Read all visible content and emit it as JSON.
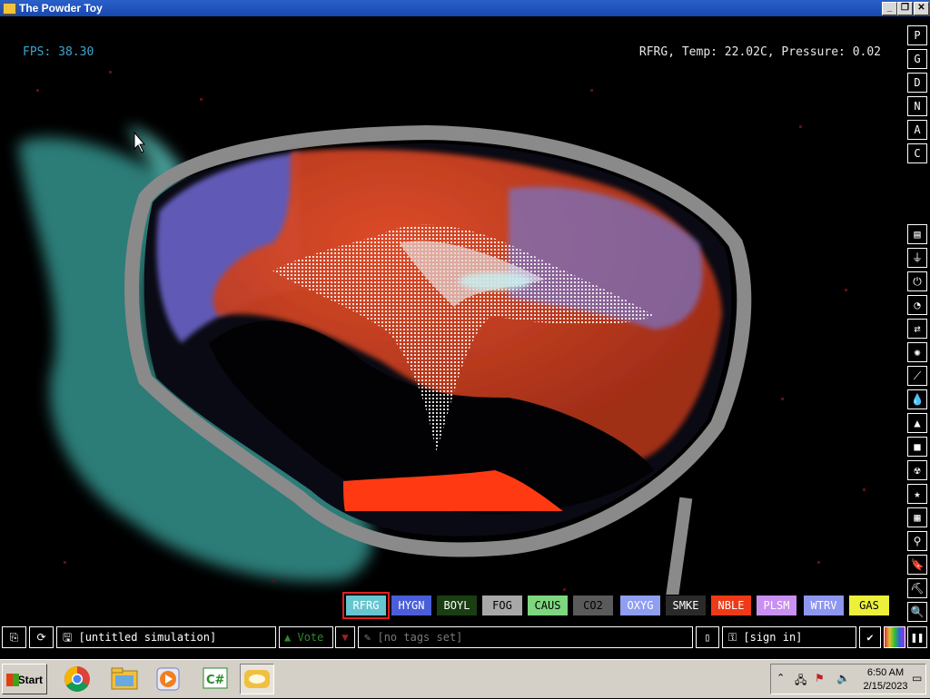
{
  "window": {
    "title": "The Powder Toy"
  },
  "hud": {
    "fps": "FPS: 38.30",
    "info": "RFRG, Temp: 22.02C, Pressure: 0.02"
  },
  "right_menu": {
    "top": [
      "P",
      "G",
      "D",
      "N",
      "A",
      "C"
    ],
    "categories": [
      "walls-icon",
      "electronics-icon",
      "powered-icon",
      "sensors-icon",
      "force-icon",
      "explosives-icon",
      "gases-icon",
      "liquids-icon",
      "powders-icon",
      "solids-icon",
      "radioactive-icon",
      "special-icon",
      "game-of-life-icon",
      "tools-icon",
      "favorites-icon",
      "decoration-icon",
      "search-icon"
    ]
  },
  "elements": [
    {
      "label": "RFRG",
      "bg": "#66c6d0",
      "fg": "#ffffff",
      "selected": true
    },
    {
      "label": "HYGN",
      "bg": "#4a5ed8",
      "fg": "#ffffff"
    },
    {
      "label": "BOYL",
      "bg": "#1a3d12",
      "fg": "#ffffff"
    },
    {
      "label": "FOG",
      "bg": "#a8a8a8",
      "fg": "#000000"
    },
    {
      "label": "CAUS",
      "bg": "#7ed67e",
      "fg": "#000000"
    },
    {
      "label": "CO2",
      "bg": "#5a5a5a",
      "fg": "#000000"
    },
    {
      "label": "OXYG",
      "bg": "#8f9ef0",
      "fg": "#ffffff"
    },
    {
      "label": "SMKE",
      "bg": "#2a2a2a",
      "fg": "#ffffff"
    },
    {
      "label": "NBLE",
      "bg": "#ee3a18",
      "fg": "#ffffff"
    },
    {
      "label": "PLSM",
      "bg": "#c890f0",
      "fg": "#ffffff"
    },
    {
      "label": "WTRV",
      "bg": "#8e96f0",
      "fg": "#ffffff"
    },
    {
      "label": "GAS",
      "bg": "#ecf03a",
      "fg": "#000000"
    }
  ],
  "bottom_bar": {
    "sim_name": "[untitled simulation]",
    "vote": "Vote",
    "tags": "[no tags set]",
    "sign_in": "[sign in]"
  },
  "taskbar": {
    "start": "Start",
    "time": "6:50 AM",
    "date": "2/15/2023",
    "programs": [
      "chrome-icon",
      "explorer-icon",
      "media-player-icon",
      "csharp-icon",
      "powder-toy-icon"
    ]
  }
}
